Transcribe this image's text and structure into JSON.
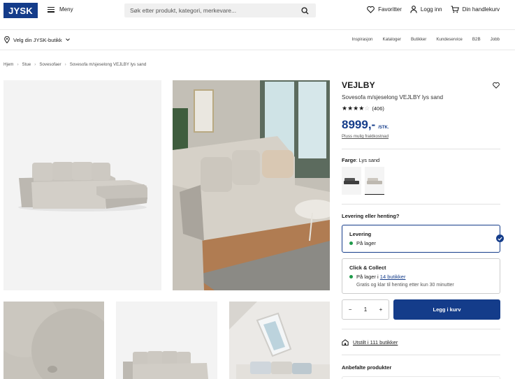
{
  "header": {
    "logo_text": "JYSK",
    "menu_label": "Meny",
    "search_placeholder": "Søk etter produkt, kategori, merkevare...",
    "favorites_label": "Favoritter",
    "login_label": "Logg inn",
    "cart_label": "Din handlekurv"
  },
  "storebar": {
    "store_label": "Velg din JYSK-butikk",
    "links": [
      "Inspirasjon",
      "Kataloger",
      "Butikker",
      "Kundeservice",
      "B2B",
      "Jobb"
    ]
  },
  "breadcrumb": [
    "Hjem",
    "Stue",
    "Sovesofaer",
    "Sovesofa m/sjeselong VEJLBY lys sand"
  ],
  "product": {
    "title": "VEJLBY",
    "subtitle": "Sovesofa m/sjeselong VEJLBY lys sand",
    "rating": 4,
    "review_count": "(406)",
    "price": "8999,-",
    "price_unit": "/STK.",
    "freight_link": "Pluss mulig fraktkostnad",
    "color_label": "Farge",
    "color_value": ": Lys sand",
    "swatches": [
      "dark-grey-sofa",
      "light-sand-sofa"
    ],
    "delivery_question": "Levering eller henting?",
    "delivery": {
      "name": "Levering",
      "status": "På lager"
    },
    "collect": {
      "name": "Click & Collect",
      "status_prefix": "På lager i ",
      "status_link": "14 butikker",
      "note": "Gratis og klar til henting etter kun 30 minutter"
    },
    "quantity": "1",
    "add_to_cart": "Legg i kurv",
    "stock_link": "Utstilt i 111 butikker",
    "recommended": "Anbefalte produkter"
  },
  "colors": {
    "brand": "#143c8a",
    "in_stock": "#1f9a4a"
  }
}
